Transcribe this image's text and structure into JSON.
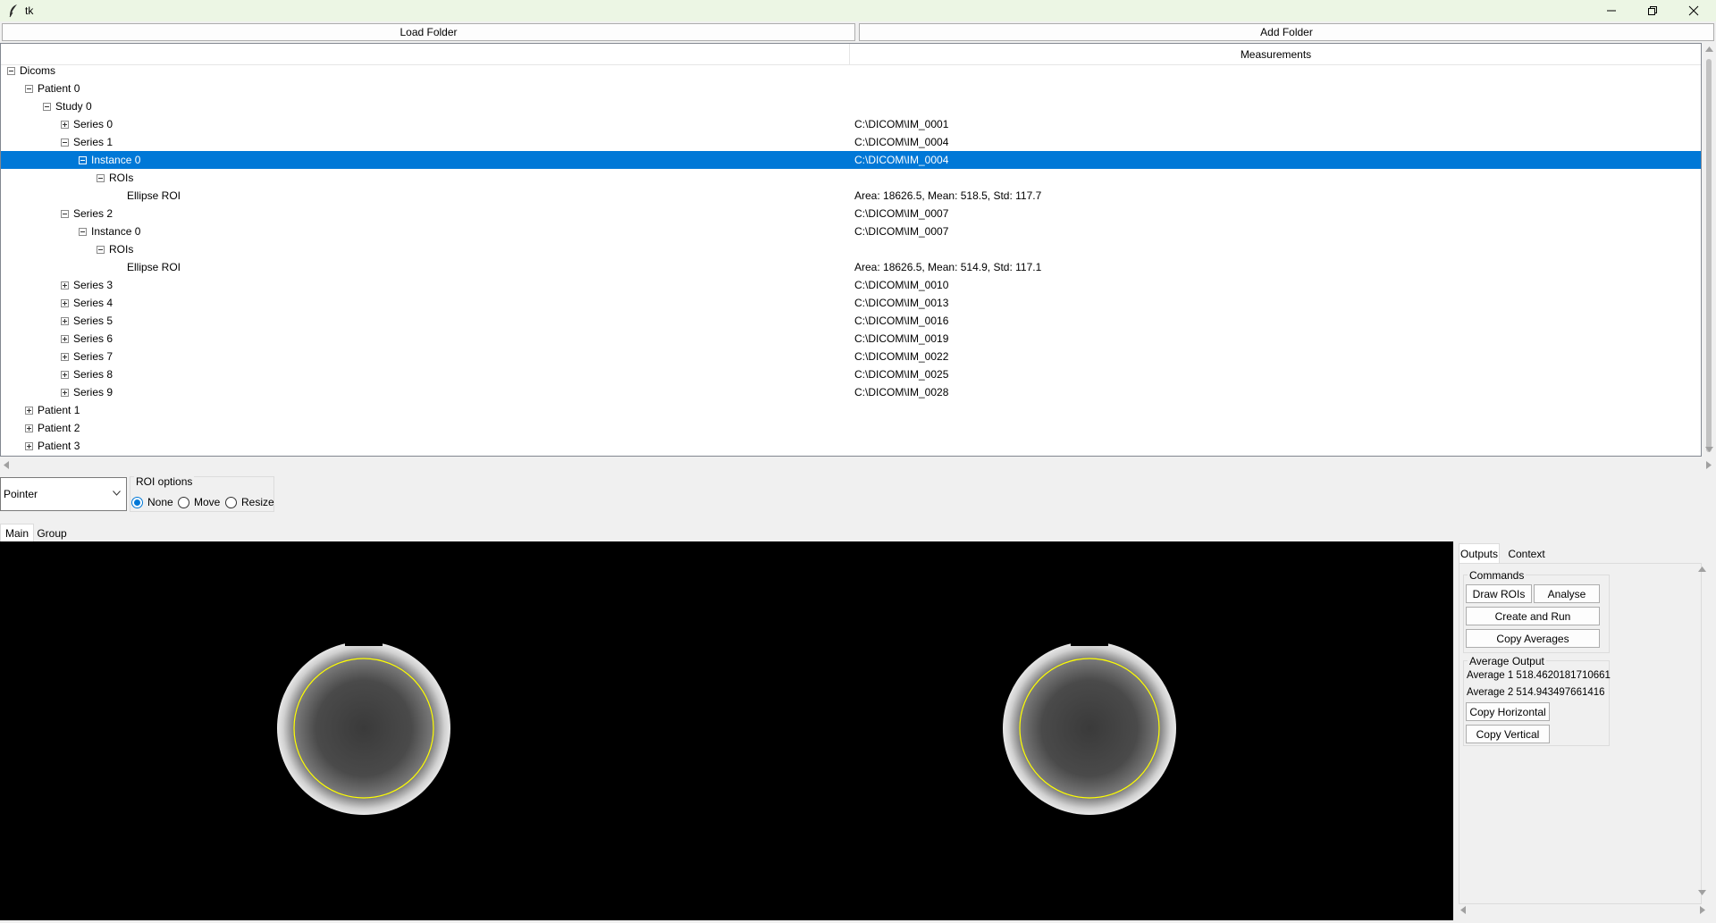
{
  "window": {
    "title": "tk"
  },
  "toolbar": {
    "load_label": "Load Folder",
    "add_label": "Add Folder"
  },
  "tree": {
    "columns": [
      "",
      "Measurements"
    ],
    "rows": [
      {
        "label": "Dicoms",
        "value": "",
        "depth": 0,
        "toggle": "minus"
      },
      {
        "label": "Patient 0",
        "value": "",
        "depth": 1,
        "toggle": "minus"
      },
      {
        "label": "Study 0",
        "value": "",
        "depth": 2,
        "toggle": "minus"
      },
      {
        "label": "Series 0",
        "value": "C:\\DICOM\\IM_0001",
        "depth": 3,
        "toggle": "plus"
      },
      {
        "label": "Series 1",
        "value": "C:\\DICOM\\IM_0004",
        "depth": 3,
        "toggle": "minus"
      },
      {
        "label": "Instance 0",
        "value": "C:\\DICOM\\IM_0004",
        "depth": 4,
        "toggle": "minus",
        "selected": true
      },
      {
        "label": "ROIs",
        "value": "",
        "depth": 5,
        "toggle": "minus"
      },
      {
        "label": "Ellipse ROI",
        "value": "Area: 18626.5, Mean: 518.5, Std: 117.7",
        "depth": 6,
        "toggle": "none"
      },
      {
        "label": "Series 2",
        "value": "C:\\DICOM\\IM_0007",
        "depth": 3,
        "toggle": "minus"
      },
      {
        "label": "Instance 0",
        "value": "C:\\DICOM\\IM_0007",
        "depth": 4,
        "toggle": "minus"
      },
      {
        "label": "ROIs",
        "value": "",
        "depth": 5,
        "toggle": "minus"
      },
      {
        "label": "Ellipse ROI",
        "value": "Area: 18626.5, Mean: 514.9, Std: 117.1",
        "depth": 6,
        "toggle": "none"
      },
      {
        "label": "Series 3",
        "value": "C:\\DICOM\\IM_0010",
        "depth": 3,
        "toggle": "plus"
      },
      {
        "label": "Series 4",
        "value": "C:\\DICOM\\IM_0013",
        "depth": 3,
        "toggle": "plus"
      },
      {
        "label": "Series 5",
        "value": "C:\\DICOM\\IM_0016",
        "depth": 3,
        "toggle": "plus"
      },
      {
        "label": "Series 6",
        "value": "C:\\DICOM\\IM_0019",
        "depth": 3,
        "toggle": "plus"
      },
      {
        "label": "Series 7",
        "value": "C:\\DICOM\\IM_0022",
        "depth": 3,
        "toggle": "plus"
      },
      {
        "label": "Series 8",
        "value": "C:\\DICOM\\IM_0025",
        "depth": 3,
        "toggle": "plus"
      },
      {
        "label": "Series 9",
        "value": "C:\\DICOM\\IM_0028",
        "depth": 3,
        "toggle": "plus"
      },
      {
        "label": "Patient 1",
        "value": "",
        "depth": 1,
        "toggle": "plus"
      },
      {
        "label": "Patient 2",
        "value": "",
        "depth": 1,
        "toggle": "plus"
      },
      {
        "label": "Patient 3",
        "value": "",
        "depth": 1,
        "toggle": "plus"
      }
    ]
  },
  "controls": {
    "tool_selected": "Pointer",
    "roi_options": {
      "legend": "ROI options",
      "options": [
        "None",
        "Move",
        "Resize"
      ],
      "selected": "None"
    }
  },
  "tabs": {
    "main": "Main",
    "group": "Group"
  },
  "viewer": {
    "roi_color": "#ffff00"
  },
  "right_panel": {
    "tabs": [
      "Outputs",
      "Context"
    ],
    "commands": {
      "legend": "Commands",
      "draw_rois": "Draw ROIs",
      "analyse": "Analyse",
      "create_and_run": "Create and Run",
      "copy_averages": "Copy Averages"
    },
    "average_output": {
      "legend": "Average Output",
      "average1": "Average 1 518.4620181710661",
      "average2": "Average 2 514.943497661416",
      "copy_horizontal": "Copy Horizontal",
      "copy_vertical": "Copy Vertical"
    }
  },
  "colors": {
    "selection": "#0078d7",
    "window_titlebar": "#ecf6e4"
  }
}
